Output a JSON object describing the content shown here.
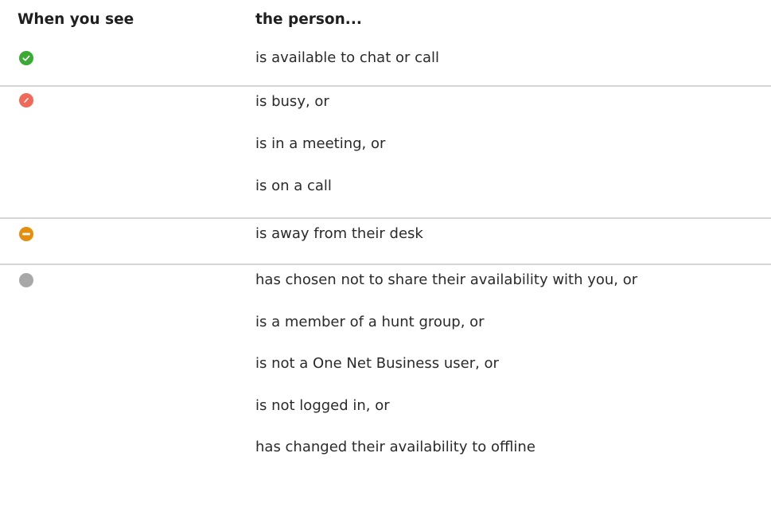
{
  "table": {
    "header": {
      "col1": "When you see",
      "col2": "the person..."
    },
    "rows": [
      {
        "icon": "available-check-icon",
        "color": "#3aaa35",
        "lines": [
          "is available to chat or call"
        ]
      },
      {
        "icon": "busy-slash-icon",
        "color": "#f0695a",
        "lines": [
          "is busy, or",
          "is in a meeting, or",
          "is on a call"
        ]
      },
      {
        "icon": "away-minus-icon",
        "color": "#e58d0c",
        "lines": [
          "is away from their desk"
        ]
      },
      {
        "icon": "offline-dot-icon",
        "color": "#a8a8a8",
        "lines": [
          "has chosen not to share their availability with you, or",
          "is a member of a hunt group, or",
          "is not a One Net Business user, or",
          "is not logged in, or",
          "has changed their availability to offline"
        ]
      }
    ]
  }
}
